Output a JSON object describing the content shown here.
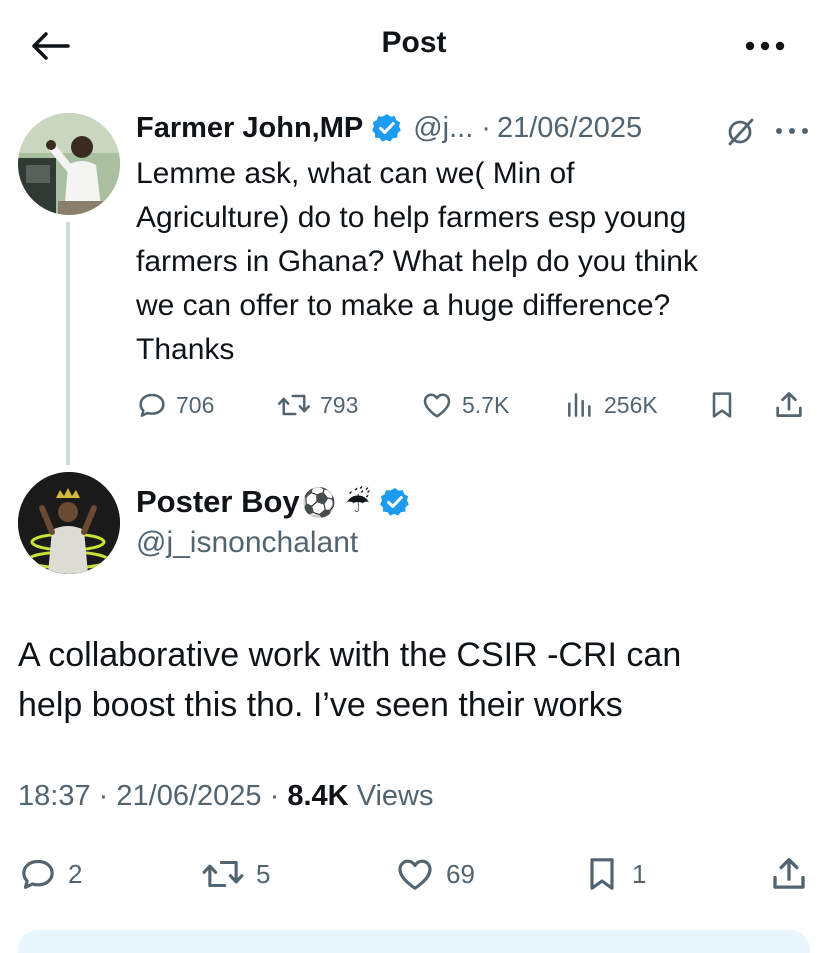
{
  "header": {
    "title": "Post",
    "back_icon": "arrow-left-icon",
    "more_icon": "more-horizontal-icon"
  },
  "parent_post": {
    "author_name": "Farmer John,MP",
    "handle": "@j...",
    "date": "21/06/2025",
    "separator": "·",
    "text": "Lemme ask, what can we( Min of\nAgriculture) do to help farmers esp young\nfarmers in Ghana? What help do you think\nwe can offer to make a huge difference?\nThanks",
    "replies": "706",
    "reposts": "793",
    "likes": "5.7K",
    "views": "256K"
  },
  "reply_post": {
    "author_name": "Poster Boy",
    "emojis": "⚽ ☔",
    "handle": "@j_isnonchalant",
    "text": "A collaborative work with the CSIR -CRI can\nhelp boost this tho. I’ve seen their works",
    "time": "18:37",
    "date": "21/06/2025",
    "separator": "·",
    "views_count": "8.4K",
    "views_label": "Views",
    "replies": "2",
    "reposts": "5",
    "likes": "69",
    "bookmarks": "1"
  },
  "colors": {
    "text": "#0f1419",
    "secondary": "#536471",
    "verified": "#1d9bf0",
    "thread_line": "#cfd9de",
    "reply_strip": "#e8f5fd"
  }
}
